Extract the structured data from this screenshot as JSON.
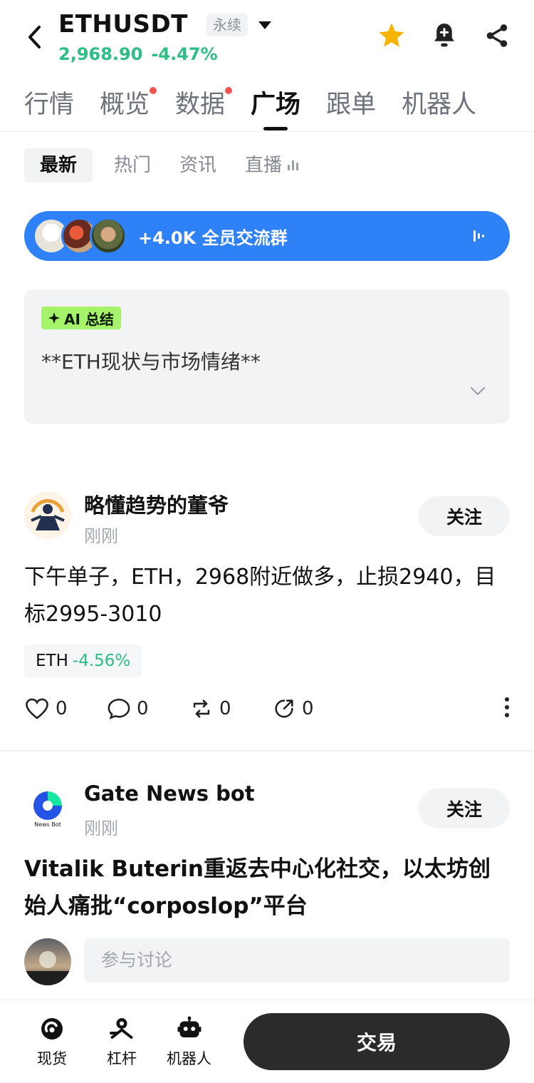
{
  "header": {
    "symbol": "ETHUSDT",
    "contract_type": "永续",
    "price": "2,968.90",
    "change": "-4.47%",
    "colors": {
      "up": "#2dbd85",
      "star": "#f5b400"
    }
  },
  "main_tabs": [
    {
      "label": "行情",
      "dot": false
    },
    {
      "label": "概览",
      "dot": true
    },
    {
      "label": "数据",
      "dot": true
    },
    {
      "label": "广场",
      "dot": false,
      "active": true
    },
    {
      "label": "跟单",
      "dot": false
    },
    {
      "label": "机器人",
      "dot": false
    }
  ],
  "sub_tabs": [
    {
      "label": "最新",
      "active": true
    },
    {
      "label": "热门"
    },
    {
      "label": "资讯"
    },
    {
      "label": "直播"
    }
  ],
  "group_banner": {
    "text": "+4.0K 全员交流群",
    "color": "#2f81f7"
  },
  "ai_summary": {
    "badge": "AI 总结",
    "text": "**ETH现状与市场情绪**"
  },
  "posts": [
    {
      "author": "略懂趋势的董爷",
      "time": "刚刚",
      "follow": "关注",
      "body": "下午单子，ETH，2968附近做多，止损2940，目标2995-3010",
      "ticker": {
        "symbol": "ETH",
        "change": "-4.56%"
      },
      "likes": "0",
      "comments": "0",
      "reposts": "0",
      "shares": "0"
    },
    {
      "author": "Gate News bot",
      "avatar_caption": "News Bot",
      "time": "刚刚",
      "follow": "关注",
      "headline": "Vitalik Buterin重返去中心化社交，以太坊创始人痛批“corposlop”平台"
    }
  ],
  "comment": {
    "placeholder": "参与讨论"
  },
  "bottom_bar": {
    "items": [
      {
        "label": "现货",
        "icon": "spot-icon"
      },
      {
        "label": "杠杆",
        "icon": "margin-icon"
      },
      {
        "label": "机器人",
        "icon": "robot-icon"
      }
    ],
    "trade": "交易"
  }
}
